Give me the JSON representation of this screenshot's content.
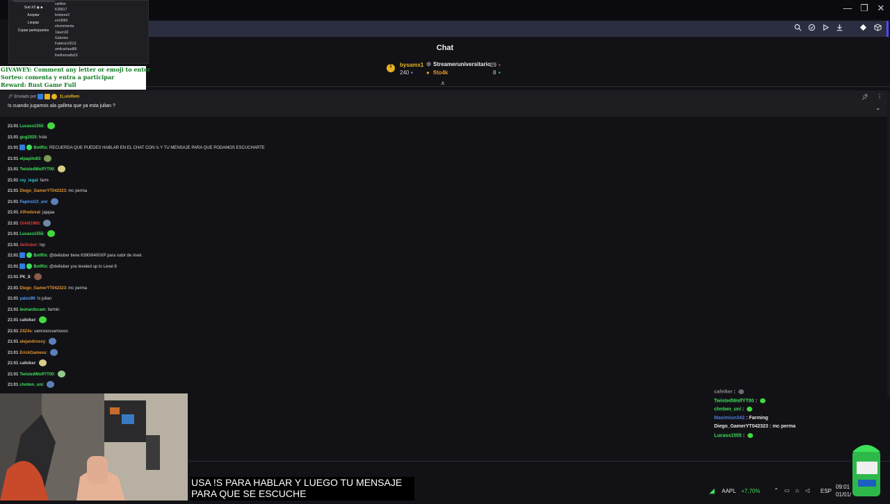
{
  "window": {
    "minimize_glyph": "—",
    "restore_glyph": "❐",
    "close_glyph": "✕"
  },
  "toolbar": {
    "icons": [
      "search-icon",
      "shield-icon",
      "play-icon",
      "download-icon",
      "gem-icon",
      "cube-icon"
    ]
  },
  "chat": {
    "title": "Chat"
  },
  "gifters": {
    "rank_badge": "1",
    "first_user": "bysamx1",
    "first_count": "240",
    "second_user": "Streameruniversitario",
    "second_count": "29",
    "third_user": "fito4k",
    "third_count": "8"
  },
  "overlay_panel": {
    "sub_label": "Sub X2",
    "accept_label": "Aceptar",
    "clear_label": "Limpiar",
    "copy_label": "Copiar participantes",
    "participants": [
      "carlitxe",
      "K30617",
      "brnbeee2",
      "erri3060",
      "elcommenta",
      "1laurn32",
      "Gatooes",
      "Fabricio19111",
      "amilcarfaad89",
      "fivetheroalfa16"
    ]
  },
  "giveaway": {
    "line1": "GIVAWEY: Comment any letter or emoji to enter",
    "line2": "Sorteo: comenta y entra a participar",
    "line3": "Reward: Rust Game Full"
  },
  "pinned": {
    "sent_by": "Enviado por",
    "user": "1LuisRem",
    "message": "!s cuando jugamos ala galleta que ya esta julian ?"
  },
  "messages": [
    {
      "time": "21:01",
      "user": "Lucass1555",
      "text": "",
      "color": "#3ee05a",
      "emote": "#43d93f"
    },
    {
      "time": "21:01",
      "user": "gog2025",
      "text": "hola",
      "color": "#3ee05a",
      "emote": ""
    },
    {
      "time": "21:01",
      "user": "BotRix",
      "text": "RECUERDA QUE PUEDES HABLAR EN EL CHAT CON !s Y TU MENSAJE PARA QUE PODAMOS ESCUCHARTE",
      "color": "#3ee05a",
      "emote": ""
    },
    {
      "time": "21:01",
      "user": "elpapito83",
      "text": "",
      "color": "#3ee05a",
      "emote": "#7a9a55"
    },
    {
      "time": "21:01",
      "user": "TwistedWolfYT00",
      "text": "",
      "color": "#3ee05a",
      "emote": "#d8cc8a"
    },
    {
      "time": "21:01",
      "user": "rey_legal",
      "text": "farm",
      "color": "#2ec2c8",
      "emote": ""
    },
    {
      "time": "21:01",
      "user": "Diego_GamerYT042323",
      "text": "mc perma",
      "color": "#e2952f",
      "emote": ""
    },
    {
      "time": "21:01",
      "user": "Papiro11f_uni",
      "text": "",
      "color": "#4ea0ff",
      "emote": "#5b7fb8"
    },
    {
      "time": "21:01",
      "user": "Alfredoval",
      "text": "jajajaa",
      "color": "#e2952f",
      "emote": ""
    },
    {
      "time": "21:01",
      "user": "GIAN1960",
      "text": "",
      "color": "#e03a3a",
      "emote": "#6f8aa6"
    },
    {
      "time": "21:01",
      "user": "Lucass1555",
      "text": "",
      "color": "#3ee05a",
      "emote": "#43d93f"
    },
    {
      "time": "21:01",
      "user": "deiliuber",
      "text": "!xp",
      "color": "#e03a3a",
      "emote": ""
    },
    {
      "time": "21:01",
      "user": "BotRix",
      "text": "@deiliuber tiene 6390/6400XP para subir de nivel.",
      "color": "#3ee05a",
      "emote": ""
    },
    {
      "time": "21:01",
      "user": "BotRix",
      "text": "@deiliuber you leveled up to Level 8",
      "color": "#3ee05a",
      "emote": ""
    },
    {
      "time": "21:01",
      "user": "PK_8",
      "text": "",
      "color": "#d0d0d6",
      "emote": "#8a5a4a"
    },
    {
      "time": "21:01",
      "user": "Diego_GamerYT042323",
      "text": "mc perma",
      "color": "#e2952f",
      "emote": ""
    },
    {
      "time": "21:01",
      "user": "yalos90",
      "text": "!s julian",
      "color": "#4ea0ff",
      "emote": ""
    },
    {
      "time": "21:01",
      "user": "leonardxcam",
      "text": "farmin",
      "color": "#3ee05a",
      "emote": ""
    },
    {
      "time": "21:01",
      "user": "cafeiker",
      "text": "",
      "color": "#d0d0d6",
      "emote": "#43d93f"
    },
    {
      "time": "21:01",
      "user": "Z4Z4s",
      "text": "vamooosvamooos",
      "color": "#e2952f",
      "emote": ""
    },
    {
      "time": "21:01",
      "user": "alejandrosxy",
      "text": "",
      "color": "#e2952f",
      "emote": "#5b7fb8"
    },
    {
      "time": "21:01",
      "user": "ErickGamess",
      "text": "",
      "color": "#e2952f",
      "emote": "#5b7fb8"
    },
    {
      "time": "21:01",
      "user": "cafeiker",
      "text": "",
      "color": "#d0d0d6",
      "emote": "#d8cc8a"
    },
    {
      "time": "21:01",
      "user": "TwistedWolfYT00",
      "text": "",
      "color": "#3ee05a",
      "emote": "#8fc98a"
    },
    {
      "time": "21:01",
      "user": "chntwn_uni",
      "text": "",
      "color": "#3ee05a",
      "emote": "#5b7fb8"
    }
  ],
  "subtitle": {
    "line1": "USA !S PARA HABLAR Y LUEGO TU MENSAJE",
    "line2": "PARA QUE SE ESCUCHE"
  },
  "mini_chat": [
    {
      "user": "cafeiker",
      "text": "",
      "color": "#8a8a90"
    },
    {
      "user": "TwistedWolfYT00",
      "text": "",
      "color": "#3ee05a"
    },
    {
      "user": "chntwn_uni",
      "text": "",
      "color": "#3ee05a"
    },
    {
      "user": "Maximiun342",
      "text": "Farming",
      "color": "#4e7bd6"
    },
    {
      "user": "Diego_GamerYT042323",
      "text": "mc perma",
      "color": "#e6e6ea"
    },
    {
      "user": "Lucass1555",
      "text": "",
      "color": "#3ee05a"
    }
  ],
  "taskbar": {
    "ticker": "AAPL",
    "change": "+7,70%",
    "language": "ESP",
    "time": "09:01",
    "date": "01/01/"
  },
  "colors": {
    "accent": "#4d4dff",
    "green": "#3ee05a",
    "gold": "#e8b21f"
  }
}
